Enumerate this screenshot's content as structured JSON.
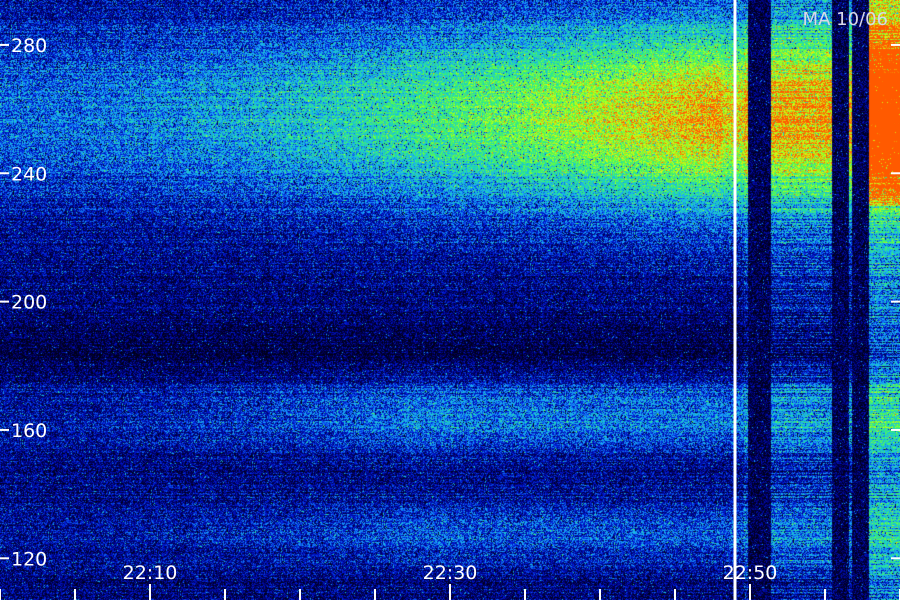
{
  "chart_data": {
    "type": "heatmap",
    "title": "",
    "station_label": "MA 10/06",
    "xlabel": "",
    "ylabel": "",
    "x_ticks": [
      "22:10",
      "22:30",
      "22:50"
    ],
    "x_tick_values_min": [
      10,
      30,
      50
    ],
    "x_range_min": [
      0,
      60
    ],
    "y_ticks": [
      120,
      160,
      200,
      240,
      280
    ],
    "y_range": [
      107,
      294
    ],
    "colormap": [
      "#000018",
      "#00006a",
      "#0018d8",
      "#1aa8ff",
      "#20e0a8",
      "#60ff40",
      "#d8ff10",
      "#ff5a00"
    ],
    "marker_time_min": 49,
    "emission_bands": [
      {
        "y_center": 258,
        "y_halfwidth": 30,
        "peak": 0.82,
        "t_start_min": 0,
        "t_peak_min": 48
      },
      {
        "y_center": 165,
        "y_halfwidth": 12,
        "peak": 0.28,
        "t_start_min": 0,
        "t_peak_min": 30
      },
      {
        "y_center": 128,
        "y_halfwidth": 10,
        "peak": 0.2,
        "t_start_min": 0,
        "t_peak_min": 30
      }
    ]
  },
  "colors": {
    "marker_line": "#ffffff",
    "axis_ticks": "#ffffff"
  }
}
